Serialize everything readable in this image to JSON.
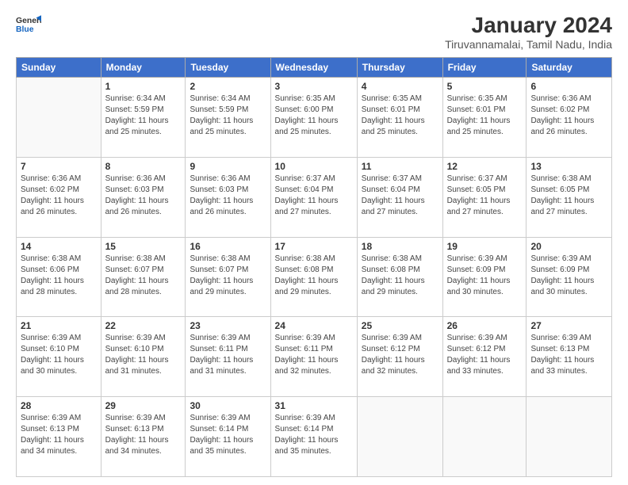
{
  "header": {
    "title": "January 2024",
    "subtitle": "Tiruvannamalai, Tamil Nadu, India",
    "logo_general": "General",
    "logo_blue": "Blue"
  },
  "days_of_week": [
    "Sunday",
    "Monday",
    "Tuesday",
    "Wednesday",
    "Thursday",
    "Friday",
    "Saturday"
  ],
  "weeks": [
    [
      {
        "day": "",
        "sunrise": "",
        "sunset": "",
        "daylight": ""
      },
      {
        "day": "1",
        "sunrise": "Sunrise: 6:34 AM",
        "sunset": "Sunset: 5:59 PM",
        "daylight": "Daylight: 11 hours and 25 minutes."
      },
      {
        "day": "2",
        "sunrise": "Sunrise: 6:34 AM",
        "sunset": "Sunset: 5:59 PM",
        "daylight": "Daylight: 11 hours and 25 minutes."
      },
      {
        "day": "3",
        "sunrise": "Sunrise: 6:35 AM",
        "sunset": "Sunset: 6:00 PM",
        "daylight": "Daylight: 11 hours and 25 minutes."
      },
      {
        "day": "4",
        "sunrise": "Sunrise: 6:35 AM",
        "sunset": "Sunset: 6:01 PM",
        "daylight": "Daylight: 11 hours and 25 minutes."
      },
      {
        "day": "5",
        "sunrise": "Sunrise: 6:35 AM",
        "sunset": "Sunset: 6:01 PM",
        "daylight": "Daylight: 11 hours and 25 minutes."
      },
      {
        "day": "6",
        "sunrise": "Sunrise: 6:36 AM",
        "sunset": "Sunset: 6:02 PM",
        "daylight": "Daylight: 11 hours and 26 minutes."
      }
    ],
    [
      {
        "day": "7",
        "sunrise": "Sunrise: 6:36 AM",
        "sunset": "Sunset: 6:02 PM",
        "daylight": "Daylight: 11 hours and 26 minutes."
      },
      {
        "day": "8",
        "sunrise": "Sunrise: 6:36 AM",
        "sunset": "Sunset: 6:03 PM",
        "daylight": "Daylight: 11 hours and 26 minutes."
      },
      {
        "day": "9",
        "sunrise": "Sunrise: 6:36 AM",
        "sunset": "Sunset: 6:03 PM",
        "daylight": "Daylight: 11 hours and 26 minutes."
      },
      {
        "day": "10",
        "sunrise": "Sunrise: 6:37 AM",
        "sunset": "Sunset: 6:04 PM",
        "daylight": "Daylight: 11 hours and 27 minutes."
      },
      {
        "day": "11",
        "sunrise": "Sunrise: 6:37 AM",
        "sunset": "Sunset: 6:04 PM",
        "daylight": "Daylight: 11 hours and 27 minutes."
      },
      {
        "day": "12",
        "sunrise": "Sunrise: 6:37 AM",
        "sunset": "Sunset: 6:05 PM",
        "daylight": "Daylight: 11 hours and 27 minutes."
      },
      {
        "day": "13",
        "sunrise": "Sunrise: 6:38 AM",
        "sunset": "Sunset: 6:05 PM",
        "daylight": "Daylight: 11 hours and 27 minutes."
      }
    ],
    [
      {
        "day": "14",
        "sunrise": "Sunrise: 6:38 AM",
        "sunset": "Sunset: 6:06 PM",
        "daylight": "Daylight: 11 hours and 28 minutes."
      },
      {
        "day": "15",
        "sunrise": "Sunrise: 6:38 AM",
        "sunset": "Sunset: 6:07 PM",
        "daylight": "Daylight: 11 hours and 28 minutes."
      },
      {
        "day": "16",
        "sunrise": "Sunrise: 6:38 AM",
        "sunset": "Sunset: 6:07 PM",
        "daylight": "Daylight: 11 hours and 29 minutes."
      },
      {
        "day": "17",
        "sunrise": "Sunrise: 6:38 AM",
        "sunset": "Sunset: 6:08 PM",
        "daylight": "Daylight: 11 hours and 29 minutes."
      },
      {
        "day": "18",
        "sunrise": "Sunrise: 6:38 AM",
        "sunset": "Sunset: 6:08 PM",
        "daylight": "Daylight: 11 hours and 29 minutes."
      },
      {
        "day": "19",
        "sunrise": "Sunrise: 6:39 AM",
        "sunset": "Sunset: 6:09 PM",
        "daylight": "Daylight: 11 hours and 30 minutes."
      },
      {
        "day": "20",
        "sunrise": "Sunrise: 6:39 AM",
        "sunset": "Sunset: 6:09 PM",
        "daylight": "Daylight: 11 hours and 30 minutes."
      }
    ],
    [
      {
        "day": "21",
        "sunrise": "Sunrise: 6:39 AM",
        "sunset": "Sunset: 6:10 PM",
        "daylight": "Daylight: 11 hours and 30 minutes."
      },
      {
        "day": "22",
        "sunrise": "Sunrise: 6:39 AM",
        "sunset": "Sunset: 6:10 PM",
        "daylight": "Daylight: 11 hours and 31 minutes."
      },
      {
        "day": "23",
        "sunrise": "Sunrise: 6:39 AM",
        "sunset": "Sunset: 6:11 PM",
        "daylight": "Daylight: 11 hours and 31 minutes."
      },
      {
        "day": "24",
        "sunrise": "Sunrise: 6:39 AM",
        "sunset": "Sunset: 6:11 PM",
        "daylight": "Daylight: 11 hours and 32 minutes."
      },
      {
        "day": "25",
        "sunrise": "Sunrise: 6:39 AM",
        "sunset": "Sunset: 6:12 PM",
        "daylight": "Daylight: 11 hours and 32 minutes."
      },
      {
        "day": "26",
        "sunrise": "Sunrise: 6:39 AM",
        "sunset": "Sunset: 6:12 PM",
        "daylight": "Daylight: 11 hours and 33 minutes."
      },
      {
        "day": "27",
        "sunrise": "Sunrise: 6:39 AM",
        "sunset": "Sunset: 6:13 PM",
        "daylight": "Daylight: 11 hours and 33 minutes."
      }
    ],
    [
      {
        "day": "28",
        "sunrise": "Sunrise: 6:39 AM",
        "sunset": "Sunset: 6:13 PM",
        "daylight": "Daylight: 11 hours and 34 minutes."
      },
      {
        "day": "29",
        "sunrise": "Sunrise: 6:39 AM",
        "sunset": "Sunset: 6:13 PM",
        "daylight": "Daylight: 11 hours and 34 minutes."
      },
      {
        "day": "30",
        "sunrise": "Sunrise: 6:39 AM",
        "sunset": "Sunset: 6:14 PM",
        "daylight": "Daylight: 11 hours and 35 minutes."
      },
      {
        "day": "31",
        "sunrise": "Sunrise: 6:39 AM",
        "sunset": "Sunset: 6:14 PM",
        "daylight": "Daylight: 11 hours and 35 minutes."
      },
      {
        "day": "",
        "sunrise": "",
        "sunset": "",
        "daylight": ""
      },
      {
        "day": "",
        "sunrise": "",
        "sunset": "",
        "daylight": ""
      },
      {
        "day": "",
        "sunrise": "",
        "sunset": "",
        "daylight": ""
      }
    ]
  ]
}
